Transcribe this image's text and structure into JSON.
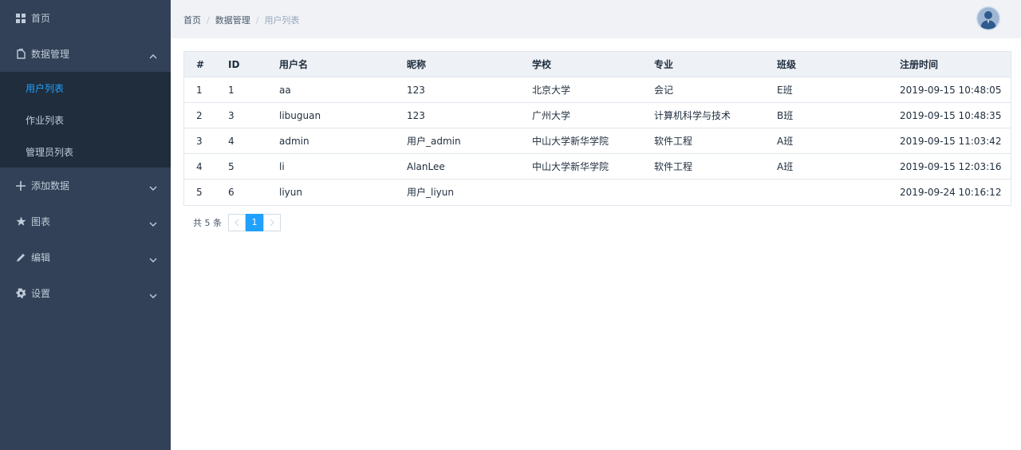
{
  "sidebar": {
    "items": [
      {
        "label": "首页",
        "icon": "grid-icon"
      },
      {
        "label": "数据管理",
        "icon": "document-icon",
        "expanded": true
      },
      {
        "label": "添加数据",
        "icon": "plus-icon"
      },
      {
        "label": "图表",
        "icon": "star-icon"
      },
      {
        "label": "编辑",
        "icon": "pencil-icon"
      },
      {
        "label": "设置",
        "icon": "gear-icon"
      }
    ],
    "submenu": [
      {
        "label": "用户列表",
        "active": true
      },
      {
        "label": "作业列表"
      },
      {
        "label": "管理员列表"
      }
    ]
  },
  "breadcrumb": [
    "首页",
    "数据管理",
    "用户列表"
  ],
  "table": {
    "headers": [
      "#",
      "ID",
      "用户名",
      "昵称",
      "学校",
      "专业",
      "班级",
      "注册时间"
    ],
    "rows": [
      [
        "1",
        "1",
        "aa",
        "123",
        "北京大学",
        "会记",
        "E班",
        "2019-09-15 10:48:05"
      ],
      [
        "2",
        "3",
        "libuguan",
        "123",
        "广州大学",
        "计算机科学与技术",
        "B班",
        "2019-09-15 10:48:35"
      ],
      [
        "3",
        "4",
        "admin",
        "用户_admin",
        "中山大学新华学院",
        "软件工程",
        "A班",
        "2019-09-15 11:03:42"
      ],
      [
        "4",
        "5",
        "li",
        "AlanLee",
        "中山大学新华学院",
        "软件工程",
        "A班",
        "2019-09-15 12:03:16"
      ],
      [
        "5",
        "6",
        "liyun",
        "用户_liyun",
        "",
        "",
        "",
        "2019-09-24 10:16:12"
      ]
    ]
  },
  "pagination": {
    "total_label": "共 5 条",
    "current_page": "1"
  },
  "colors": {
    "sidebar_bg": "#324157",
    "submenu_bg": "#1f2d3d",
    "accent": "#20a0ff",
    "header_bg": "#f0f2f5"
  }
}
